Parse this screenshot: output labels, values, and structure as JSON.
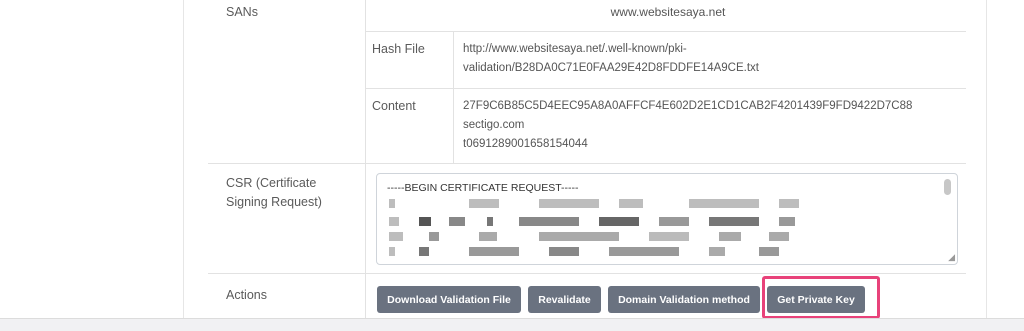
{
  "rows": {
    "sans": {
      "label": "SANs",
      "value": "www.websitesaya.net"
    },
    "hash_file": {
      "label": "Hash File",
      "value_line1": "http://www.websitesaya.net/.well-known/pki-",
      "value_line2": "validation/B28DA0C71E0FAA29E42D8FDDFE14A9CE.txt"
    },
    "content": {
      "label": "Content",
      "line1": "27F9C6B85C5D4EEC95A8A0AFFCF4E602D2E1CD1CAB2F4201439F9FD9422D7C88",
      "line2": "sectigo.com",
      "line3": "t0691289001658154044"
    },
    "csr": {
      "label_line1": "CSR (Certificate",
      "label_line2": "Signing Request)",
      "text": "-----BEGIN CERTIFICATE REQUEST-----"
    },
    "actions": {
      "label": "Actions",
      "buttons": {
        "download": "Download Validation File",
        "revalidate": "Revalidate",
        "domain_method": "Domain Validation method",
        "private_key": "Get Private Key"
      }
    }
  },
  "colors": {
    "button_bg": "#6a7280",
    "highlight": "#e8427a",
    "border": "#e2e2e2"
  }
}
